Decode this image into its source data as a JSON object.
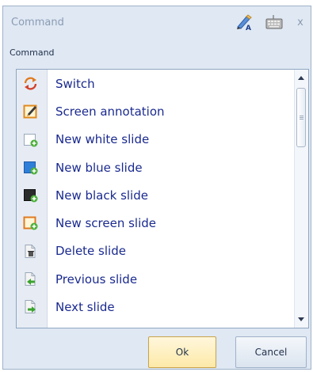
{
  "window": {
    "title": "Command",
    "icons": [
      "spell-check-icon",
      "keyboard-icon",
      "close-icon"
    ],
    "close_glyph": "x"
  },
  "section": {
    "label": "Command"
  },
  "commands": [
    {
      "label": "Switch",
      "icon": "switch-icon"
    },
    {
      "label": "Screen annotation",
      "icon": "annotation-icon"
    },
    {
      "label": "New white slide",
      "icon": "new-white-slide-icon"
    },
    {
      "label": "New blue slide",
      "icon": "new-blue-slide-icon"
    },
    {
      "label": "New black slide",
      "icon": "new-black-slide-icon"
    },
    {
      "label": "New screen slide",
      "icon": "new-screen-slide-icon"
    },
    {
      "label": "Delete  slide",
      "icon": "delete-slide-icon"
    },
    {
      "label": "Previous slide",
      "icon": "previous-slide-icon"
    },
    {
      "label": "Next slide",
      "icon": "next-slide-icon"
    }
  ],
  "buttons": {
    "ok": "Ok",
    "cancel": "Cancel"
  },
  "colors": {
    "item_text": "#1a2a8f",
    "panel": "#dfe8f3",
    "ok_button": "#fde9a8",
    "accent_orange": "#e07a1f",
    "green_plus": "#4caf3a"
  }
}
